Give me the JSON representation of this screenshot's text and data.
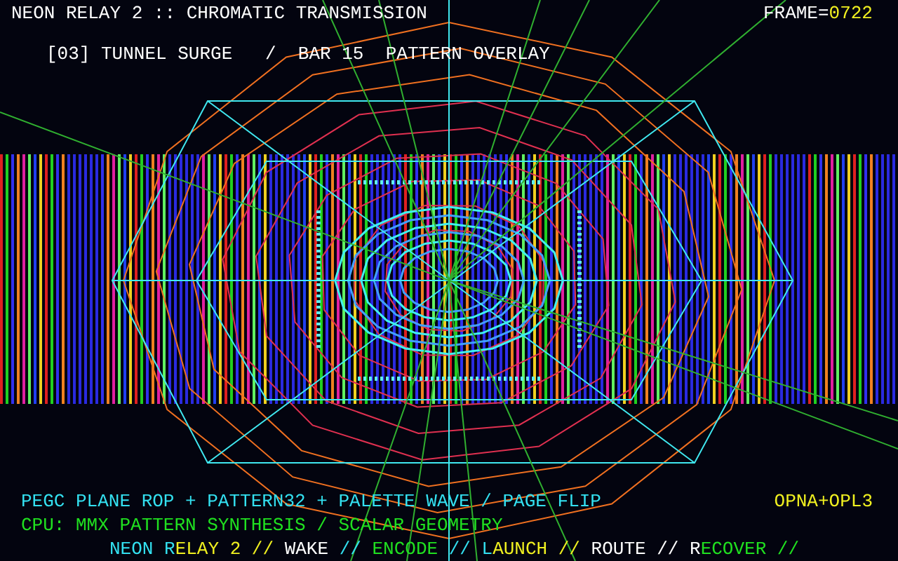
{
  "header": {
    "title": "NEON RELAY 2 :: CHROMATIC TRANSMISSION",
    "frame_label": "FRAME=",
    "frame_value": "0722",
    "scene": "[03] TUNNEL SURGE   /  BAR 15  PATTERN OVERLAY"
  },
  "footer": {
    "pipeline": "PEGC PLANE ROP + PATTERN32 + PALETTE WAVE / PAGE FLIP",
    "sound": "OPNA+OPL3",
    "cpu": "CPU: MMX PATTERN SYNTHESIS / SCALAR GEOMETRY",
    "ticker": [
      {
        "text": "NEON R",
        "color": "#33e0f0"
      },
      {
        "text": "ELAY 2 //",
        "color": "#f0f020"
      },
      {
        "text": " WAKE ",
        "color": "#ffffff"
      },
      {
        "text": "// ",
        "color": "#33e0f0"
      },
      {
        "text": "ENCODE",
        "color": "#20e020"
      },
      {
        "text": " // L",
        "color": "#33e0f0"
      },
      {
        "text": "AUNCH // ",
        "color": "#f0f020"
      },
      {
        "text": "ROUTE // R",
        "color": "#ffffff"
      },
      {
        "text": "ECOVER //",
        "color": "#20e020"
      }
    ]
  }
}
